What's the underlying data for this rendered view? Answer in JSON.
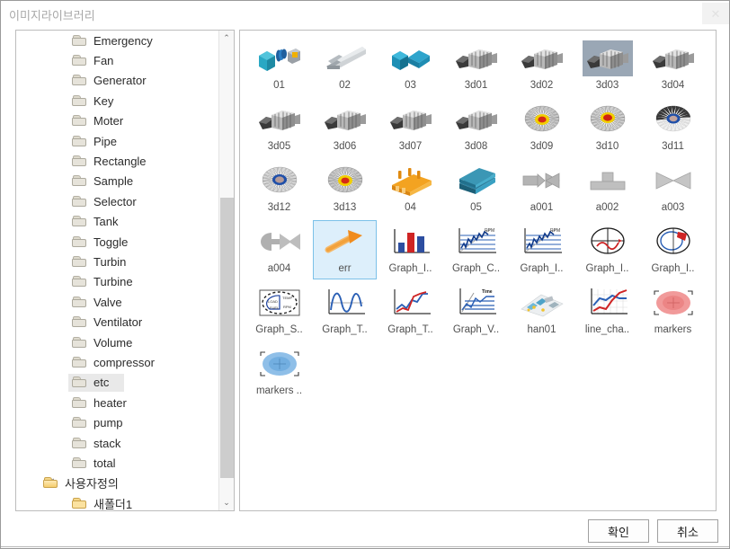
{
  "window": {
    "title": "이미지라이브러리",
    "close_label": "✕"
  },
  "tree": {
    "items": [
      {
        "label": "Emergency",
        "level": 2,
        "icon": "folder-icon",
        "selected": false,
        "expander": false
      },
      {
        "label": "Fan",
        "level": 2,
        "icon": "folder-icon",
        "selected": false,
        "expander": false
      },
      {
        "label": "Generator",
        "level": 2,
        "icon": "folder-icon",
        "selected": false,
        "expander": false
      },
      {
        "label": "Key",
        "level": 2,
        "icon": "folder-icon",
        "selected": false,
        "expander": false
      },
      {
        "label": "Moter",
        "level": 2,
        "icon": "folder-icon",
        "selected": false,
        "expander": false
      },
      {
        "label": "Pipe",
        "level": 2,
        "icon": "folder-icon",
        "selected": false,
        "expander": false
      },
      {
        "label": "Rectangle",
        "level": 2,
        "icon": "folder-icon",
        "selected": false,
        "expander": false
      },
      {
        "label": "Sample",
        "level": 2,
        "icon": "folder-icon",
        "selected": false,
        "expander": false
      },
      {
        "label": "Selector",
        "level": 2,
        "icon": "folder-icon",
        "selected": false,
        "expander": false
      },
      {
        "label": "Tank",
        "level": 2,
        "icon": "folder-icon",
        "selected": false,
        "expander": false
      },
      {
        "label": "Toggle",
        "level": 2,
        "icon": "folder-icon",
        "selected": false,
        "expander": false
      },
      {
        "label": "Turbin",
        "level": 2,
        "icon": "folder-icon",
        "selected": false,
        "expander": false
      },
      {
        "label": "Turbine",
        "level": 2,
        "icon": "folder-icon",
        "selected": false,
        "expander": false
      },
      {
        "label": "Valve",
        "level": 2,
        "icon": "folder-icon",
        "selected": false,
        "expander": false
      },
      {
        "label": "Ventilator",
        "level": 2,
        "icon": "folder-icon",
        "selected": false,
        "expander": false
      },
      {
        "label": "Volume",
        "level": 2,
        "icon": "folder-icon",
        "selected": false,
        "expander": false
      },
      {
        "label": "compressor",
        "level": 2,
        "icon": "folder-icon",
        "selected": false,
        "expander": false
      },
      {
        "label": "etc",
        "level": 2,
        "icon": "folder-icon",
        "selected": true,
        "expander": false
      },
      {
        "label": "heater",
        "level": 2,
        "icon": "folder-icon",
        "selected": false,
        "expander": false
      },
      {
        "label": "pump",
        "level": 2,
        "icon": "folder-icon",
        "selected": false,
        "expander": false
      },
      {
        "label": "stack",
        "level": 2,
        "icon": "folder-icon",
        "selected": false,
        "expander": false
      },
      {
        "label": "total",
        "level": 2,
        "icon": "folder-icon",
        "selected": false,
        "expander": false
      },
      {
        "label": "사용자정의",
        "level": 1,
        "icon": "folder-open-icon",
        "selected": false,
        "expander": true
      },
      {
        "label": "새폴더1",
        "level": 2,
        "icon": "folder-gold-icon",
        "selected": false,
        "expander": false
      }
    ],
    "scrollbar": {
      "up_arrow": "⌃",
      "down_arrow": "⌄"
    }
  },
  "grid": {
    "items": [
      {
        "label": "01",
        "icon": "cube-coupling-icon",
        "selected": false,
        "thumb_selected": false
      },
      {
        "label": "02",
        "icon": "conveyor-icon",
        "selected": false,
        "thumb_selected": false
      },
      {
        "label": "03",
        "icon": "blue-connector-icon",
        "selected": false,
        "thumb_selected": false
      },
      {
        "label": "3d01",
        "icon": "turbine-3d-icon",
        "selected": false,
        "thumb_selected": false
      },
      {
        "label": "3d02",
        "icon": "turbine-3d-icon",
        "selected": false,
        "thumb_selected": false
      },
      {
        "label": "3d03",
        "icon": "turbine-3d-icon",
        "selected": false,
        "thumb_selected": true
      },
      {
        "label": "3d04",
        "icon": "turbine-3d-icon",
        "selected": false,
        "thumb_selected": false
      },
      {
        "label": "3d05",
        "icon": "turbine-3d-icon",
        "selected": false,
        "thumb_selected": false
      },
      {
        "label": "3d06",
        "icon": "turbine-3d-icon",
        "selected": false,
        "thumb_selected": false
      },
      {
        "label": "3d07",
        "icon": "turbine-3d-icon",
        "selected": false,
        "thumb_selected": false
      },
      {
        "label": "3d08",
        "icon": "turbine-3d-icon",
        "selected": false,
        "thumb_selected": false
      },
      {
        "label": "3d09",
        "icon": "fan-yellow-icon",
        "selected": false,
        "thumb_selected": false
      },
      {
        "label": "3d10",
        "icon": "fan-red-icon",
        "selected": false,
        "thumb_selected": false
      },
      {
        "label": "3d11",
        "icon": "fan-half-icon",
        "selected": false,
        "thumb_selected": false
      },
      {
        "label": "3d12",
        "icon": "fan-blue-icon",
        "selected": false,
        "thumb_selected": false
      },
      {
        "label": "3d13",
        "icon": "fan-yellow-icon",
        "selected": false,
        "thumb_selected": false
      },
      {
        "label": "04",
        "icon": "tank-orange-icon",
        "selected": false,
        "thumb_selected": false
      },
      {
        "label": "05",
        "icon": "stack-blue-icon",
        "selected": false,
        "thumb_selected": false
      },
      {
        "label": "a001",
        "icon": "valve-a001-icon",
        "selected": false,
        "thumb_selected": false
      },
      {
        "label": "a002",
        "icon": "valve-a002-icon",
        "selected": false,
        "thumb_selected": false
      },
      {
        "label": "a003",
        "icon": "valve-a003-icon",
        "selected": false,
        "thumb_selected": false
      },
      {
        "label": "a004",
        "icon": "valve-a004-icon",
        "selected": false,
        "thumb_selected": false
      },
      {
        "label": "err",
        "icon": "orange-arrow-icon",
        "selected": true,
        "thumb_selected": false
      },
      {
        "label": "Graph_I..",
        "icon": "bar-chart-icon",
        "selected": false,
        "thumb_selected": false
      },
      {
        "label": "Graph_C..",
        "icon": "scatter-trend-icon",
        "selected": false,
        "thumb_selected": false
      },
      {
        "label": "Graph_I..",
        "icon": "scatter-trend-icon",
        "selected": false,
        "thumb_selected": false
      },
      {
        "label": "Graph_I..",
        "icon": "polar-red-icon",
        "selected": false,
        "thumb_selected": false
      },
      {
        "label": "Graph_I..",
        "icon": "polar-blue-icon",
        "selected": false,
        "thumb_selected": false
      },
      {
        "label": "Graph_S..",
        "icon": "gauge-dashed-icon",
        "selected": false,
        "thumb_selected": false
      },
      {
        "label": "Graph_T..",
        "icon": "sine-wave-icon",
        "selected": false,
        "thumb_selected": false
      },
      {
        "label": "Graph_T..",
        "icon": "line-cross-icon",
        "selected": false,
        "thumb_selected": false
      },
      {
        "label": "Graph_V..",
        "icon": "time-series-icon",
        "selected": false,
        "thumb_selected": false
      },
      {
        "label": "han01",
        "icon": "isometric-plant-icon",
        "selected": false,
        "thumb_selected": false
      },
      {
        "label": "line_cha..",
        "icon": "line-chart-icon",
        "selected": false,
        "thumb_selected": false
      },
      {
        "label": "markers",
        "icon": "marker-red-icon",
        "selected": false,
        "thumb_selected": false
      },
      {
        "label": "markers ..",
        "icon": "marker-blue-icon",
        "selected": false,
        "thumb_selected": false
      }
    ]
  },
  "footer": {
    "ok_label": "확인",
    "cancel_label": "취소"
  },
  "colors": {
    "selection_fill": "#ddeffb",
    "selection_border": "#7cc1e8",
    "thumb_selection": "#9aa7b5",
    "tree_selection": "#e9e9e9"
  }
}
